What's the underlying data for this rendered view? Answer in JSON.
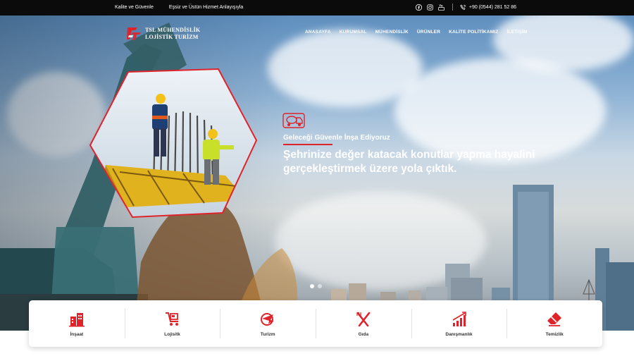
{
  "topbar": {
    "left_links": [
      "Kalite ve Güvenle",
      "Eşsiz ve Üstün Hizmet Anlayışıyla"
    ],
    "social": [
      "facebook-icon",
      "instagram-icon",
      "youtube-icon"
    ],
    "phone": "+90 (0544) 281 52 86"
  },
  "logo": {
    "line1": "TSL MÜHENDİSLİK",
    "line2": "LOJİSTİK TURİZM"
  },
  "nav": [
    "ANASAYFA",
    "KURUMSAL",
    "MÜHENDİSLİK",
    "ÜRÜNLER",
    "KALİTE POLİTİKAMIZ",
    "İLETİŞİM"
  ],
  "hero": {
    "subtitle": "Geleceği Güvenle İnşa Ediyoruz",
    "headline": "Şehrinize değer katacak konutlar yapma hayalini gerçekleştirmek üzere yola çıktık.",
    "slide_count": 2,
    "active_slide": 1
  },
  "services": [
    {
      "label": "İnşaat",
      "icon": "buildings-icon"
    },
    {
      "label": "Lojisitk",
      "icon": "logistics-icon"
    },
    {
      "label": "Turizm",
      "icon": "plane-globe-icon"
    },
    {
      "label": "Gıda",
      "icon": "fork-knife-icon"
    },
    {
      "label": "Danışmanlık",
      "icon": "growth-chart-icon"
    },
    {
      "label": "Temizlik",
      "icon": "eraser-icon"
    }
  ],
  "colors": {
    "accent": "#e0232b",
    "topbar": "#0b0b0b"
  }
}
